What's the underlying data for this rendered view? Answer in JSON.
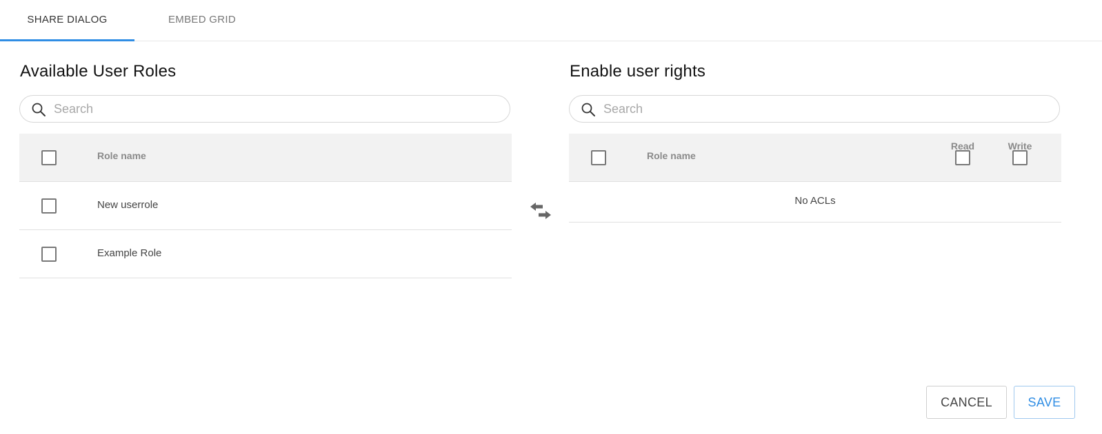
{
  "tabs": [
    {
      "label": "Share dialog",
      "active": true
    },
    {
      "label": "Embed grid",
      "active": false
    }
  ],
  "left_panel": {
    "title": "Available User Roles",
    "search_placeholder": "Search",
    "search_value": "",
    "column_header": "Role name",
    "rows": [
      {
        "name": "New userrole",
        "checked": false
      },
      {
        "name": "Example Role",
        "checked": false
      }
    ]
  },
  "right_panel": {
    "title": "Enable user rights",
    "search_placeholder": "Search",
    "search_value": "",
    "column_header": "Role name",
    "read_header": "Read",
    "write_header": "Write",
    "empty_text": "No ACLs"
  },
  "footer": {
    "cancel_label": "CANCEL",
    "save_label": "SAVE"
  },
  "icons": {
    "search": "search-icon",
    "transfer": "swap-arrows-icon"
  },
  "colors": {
    "accent": "#2f8de4",
    "header_bg": "#f2f2f2"
  }
}
